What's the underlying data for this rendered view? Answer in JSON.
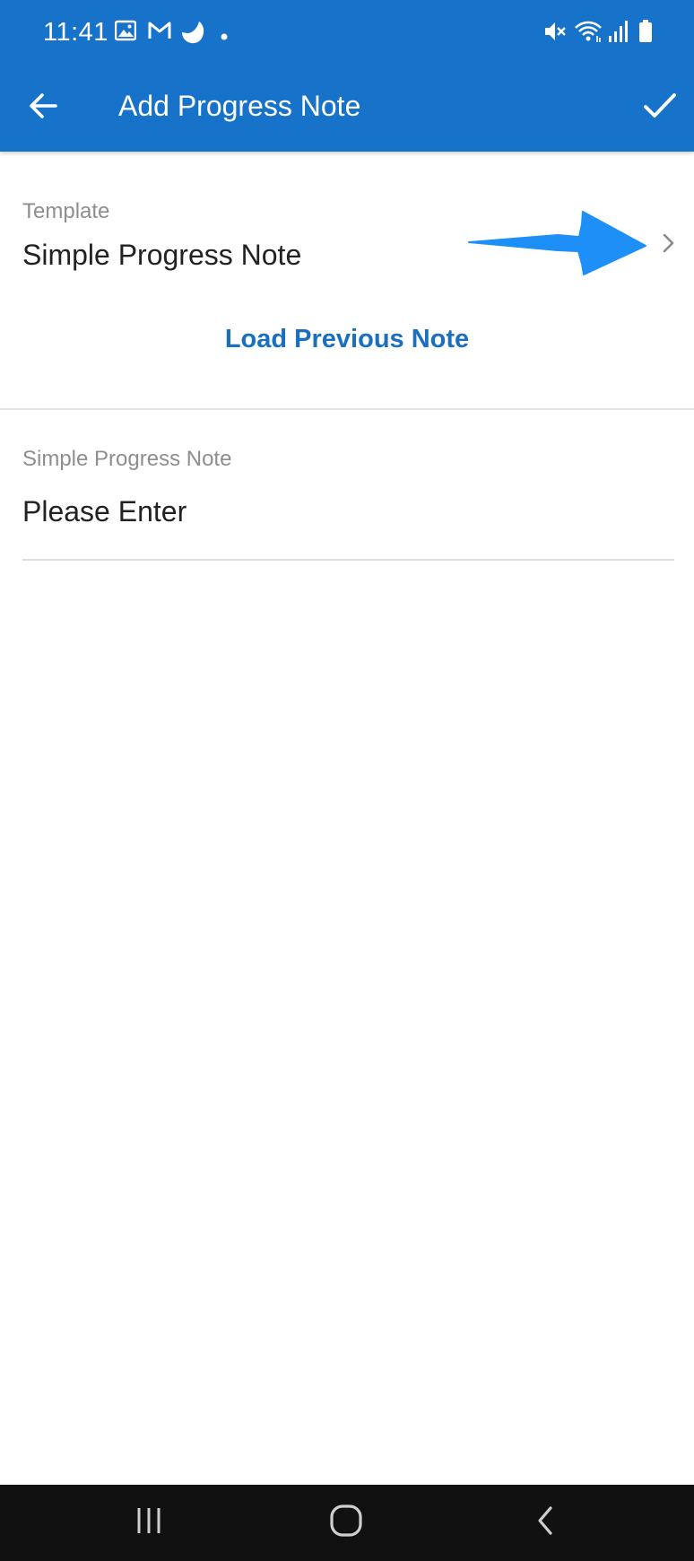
{
  "status_bar": {
    "time": "11:41",
    "left_icons": [
      "image-icon",
      "gmail-icon",
      "app-notification-icon",
      "dot-icon"
    ],
    "right_icons": [
      "mute-icon",
      "wifi-icon",
      "signal-icon",
      "battery-icon"
    ]
  },
  "toolbar": {
    "title": "Add Progress Note",
    "back_icon": "arrow-back-icon",
    "save_icon": "check-icon"
  },
  "template": {
    "label": "Template",
    "value": "Simple Progress Note",
    "chevron_icon": "chevron-right-icon"
  },
  "annotation": {
    "arrow_color": "#1e8ff7"
  },
  "load_previous": {
    "label": "Load Previous Note"
  },
  "note_field": {
    "label": "Simple Progress Note",
    "placeholder": "Please Enter"
  },
  "nav_bar": {
    "buttons": [
      "recent-apps-icon",
      "home-icon",
      "back-icon"
    ]
  },
  "colors": {
    "app_bar": "#1772c9",
    "link": "#1a6fbf",
    "nav_bar": "#111111"
  }
}
